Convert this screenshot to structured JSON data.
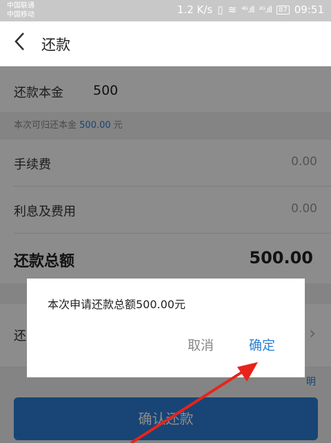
{
  "status_bar": {
    "carrier_1": "中国联通",
    "carrier_2": "中国移动",
    "speed": "1.2 K/s",
    "signal_1": "⁴ᴳ.ıll",
    "signal_2": "²ᴳ.ıll",
    "battery": "87",
    "time": "09:51"
  },
  "nav": {
    "back_icon": "chevron-left-icon",
    "title": "还款"
  },
  "form": {
    "principal_label": "还款本金",
    "principal_value": "500",
    "hint_prefix": "本次可归还本金",
    "hint_amount": "500.00",
    "hint_suffix": "元",
    "fee_label": "手续费",
    "fee_value": "0.00",
    "interest_label": "利息及费用",
    "interest_value": "0.00",
    "total_label": "还款总额",
    "total_value": "500.00",
    "method_label_visible": "还",
    "note_link_visible": "明"
  },
  "confirm_button": "确认还款",
  "dialog": {
    "message": "本次申请还款总额500.00元",
    "cancel": "取消",
    "ok": "确定"
  },
  "colors": {
    "accent": "#2d7fd8",
    "link": "#2a7fd4",
    "annotation_arrow": "#e8231b"
  }
}
